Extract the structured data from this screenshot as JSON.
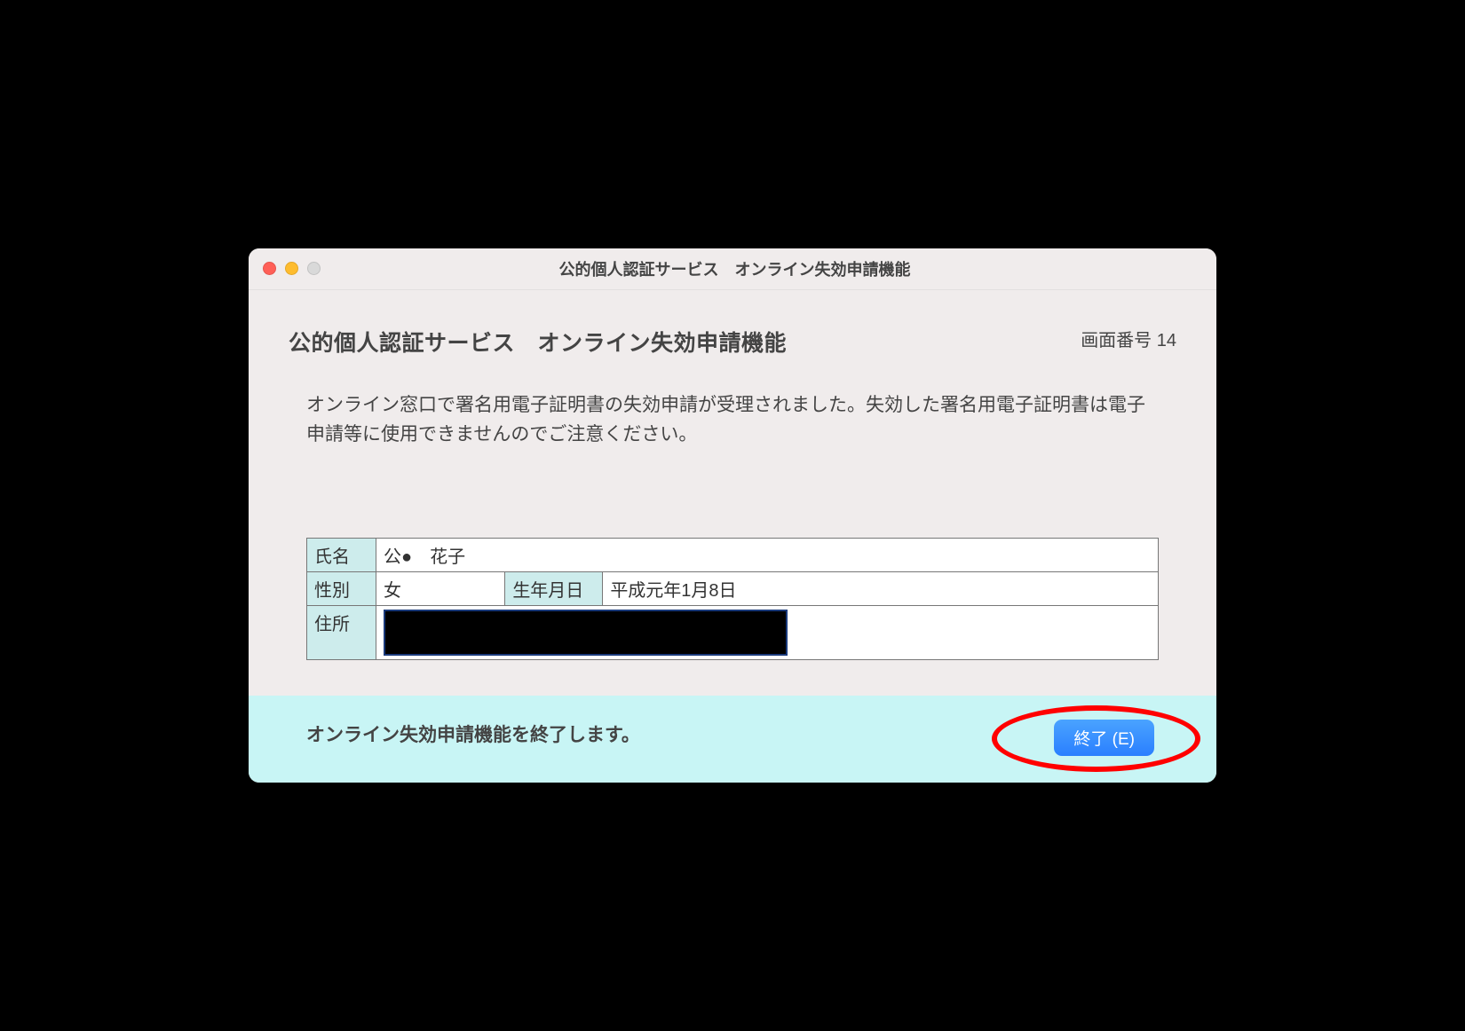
{
  "window": {
    "title": "公的個人認証サービス　オンライン失効申請機能"
  },
  "header": {
    "page_title": "公的個人認証サービス　オンライン失効申請機能",
    "screen_number": "画面番号 14"
  },
  "message": "オンライン窓口で署名用電子証明書の失効申請が受理されました。失効した署名用電子証明書は電子申請等に使用できませんのでご注意ください。",
  "info": {
    "name_label": "氏名",
    "name_value": "公●　花子",
    "gender_label": "性別",
    "gender_value": "女",
    "dob_label": "生年月日",
    "dob_value": "平成元年1月8日",
    "address_label": "住所",
    "address_value": ""
  },
  "footer": {
    "text": "オンライン失効申請機能を終了します。",
    "exit_label": "終了 (E)"
  }
}
